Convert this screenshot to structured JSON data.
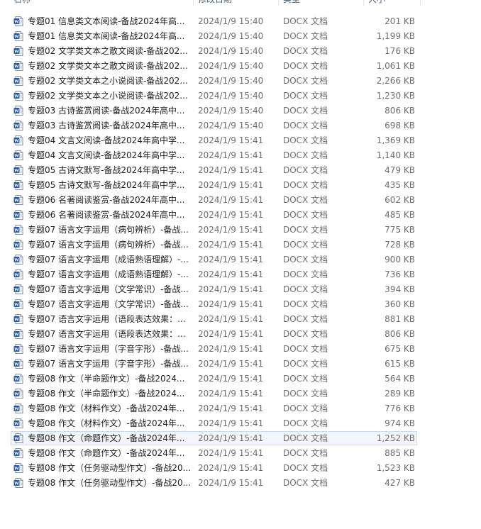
{
  "header": {
    "name": "名称",
    "date": "修改日期",
    "type": "类型",
    "size": "大小"
  },
  "icon": "word-document-icon",
  "accent_color": "#2b579a",
  "files": [
    {
      "name": "专题01 信息类文本阅读-备战2024年高...",
      "date": "2024/1/9 15:40",
      "type": "DOCX 文档",
      "size": "201 KB"
    },
    {
      "name": "专题01 信息类文本阅读-备战2024年高...",
      "date": "2024/1/9 15:40",
      "type": "DOCX 文档",
      "size": "1,199 KB"
    },
    {
      "name": "专题02 文学类文本之散文阅读-备战202...",
      "date": "2024/1/9 15:40",
      "type": "DOCX 文档",
      "size": "176 KB"
    },
    {
      "name": "专题02 文学类文本之散文阅读-备战202...",
      "date": "2024/1/9 15:40",
      "type": "DOCX 文档",
      "size": "1,061 KB"
    },
    {
      "name": "专题02 文学类文本之小说阅读-备战202...",
      "date": "2024/1/9 15:40",
      "type": "DOCX 文档",
      "size": "2,266 KB"
    },
    {
      "name": "专题02 文学类文本之小说阅读-备战202...",
      "date": "2024/1/9 15:40",
      "type": "DOCX 文档",
      "size": "1,230 KB"
    },
    {
      "name": "专题03 古诗鉴赏阅读-备战2024年高中...",
      "date": "2024/1/9 15:40",
      "type": "DOCX 文档",
      "size": "806 KB"
    },
    {
      "name": "专题03 古诗鉴赏阅读-备战2024年高中...",
      "date": "2024/1/9 15:40",
      "type": "DOCX 文档",
      "size": "698 KB"
    },
    {
      "name": "专题04 文言文阅读-备战2024年高中学...",
      "date": "2024/1/9 15:41",
      "type": "DOCX 文档",
      "size": "1,369 KB"
    },
    {
      "name": "专题04 文言文阅读-备战2024年高中学...",
      "date": "2024/1/9 15:41",
      "type": "DOCX 文档",
      "size": "1,140 KB"
    },
    {
      "name": "专题05 古诗文默写-备战2024年高中学...",
      "date": "2024/1/9 15:41",
      "type": "DOCX 文档",
      "size": "479 KB"
    },
    {
      "name": "专题05 古诗文默写-备战2024年高中学...",
      "date": "2024/1/9 15:41",
      "type": "DOCX 文档",
      "size": "435 KB"
    },
    {
      "name": "专题06 名著阅读鉴赏-备战2024年高中...",
      "date": "2024/1/9 15:41",
      "type": "DOCX 文档",
      "size": "602 KB"
    },
    {
      "name": "专题06 名著阅读鉴赏-备战2024年高中...",
      "date": "2024/1/9 15:41",
      "type": "DOCX 文档",
      "size": "485 KB"
    },
    {
      "name": "专题07 语言文字运用（病句辨析）-备战...",
      "date": "2024/1/9 15:41",
      "type": "DOCX 文档",
      "size": "775 KB"
    },
    {
      "name": "专题07 语言文字运用（病句辨析）-备战...",
      "date": "2024/1/9 15:41",
      "type": "DOCX 文档",
      "size": "728 KB"
    },
    {
      "name": "专题07 语言文字运用（成语熟语理解）-...",
      "date": "2024/1/9 15:41",
      "type": "DOCX 文档",
      "size": "900 KB"
    },
    {
      "name": "专题07 语言文字运用（成语熟语理解）-...",
      "date": "2024/1/9 15:41",
      "type": "DOCX 文档",
      "size": "736 KB"
    },
    {
      "name": "专题07 语言文字运用（文学常识）-备战...",
      "date": "2024/1/9 15:41",
      "type": "DOCX 文档",
      "size": "394 KB"
    },
    {
      "name": "专题07 语言文字运用（文学常识）-备战...",
      "date": "2024/1/9 15:41",
      "type": "DOCX 文档",
      "size": "360 KB"
    },
    {
      "name": "专题07 语言文字运用（语段表达效果：...",
      "date": "2024/1/9 15:41",
      "type": "DOCX 文档",
      "size": "881 KB"
    },
    {
      "name": "专题07 语言文字运用（语段表达效果：...",
      "date": "2024/1/9 15:41",
      "type": "DOCX 文档",
      "size": "806 KB"
    },
    {
      "name": "专题07 语言文字运用（字音字形）-备战...",
      "date": "2024/1/9 15:41",
      "type": "DOCX 文档",
      "size": "675 KB"
    },
    {
      "name": "专题07 语言文字运用（字音字形）-备战...",
      "date": "2024/1/9 15:41",
      "type": "DOCX 文档",
      "size": "615 KB"
    },
    {
      "name": "专题08 作文（半命题作文）-备战2024...",
      "date": "2024/1/9 15:41",
      "type": "DOCX 文档",
      "size": "564 KB"
    },
    {
      "name": "专题08 作文（半命题作文）-备战2024...",
      "date": "2024/1/9 15:41",
      "type": "DOCX 文档",
      "size": "289 KB"
    },
    {
      "name": "专题08 作文（材料作文）-备战2024年...",
      "date": "2024/1/9 15:41",
      "type": "DOCX 文档",
      "size": "776 KB"
    },
    {
      "name": "专题08 作文（材料作文）-备战2024年...",
      "date": "2024/1/9 15:41",
      "type": "DOCX 文档",
      "size": "974 KB"
    },
    {
      "name": "专题08 作文（命题作文）-备战2024年...",
      "date": "2024/1/9 15:41",
      "type": "DOCX 文档",
      "size": "1,252 KB",
      "selected": true
    },
    {
      "name": "专题08 作文（命题作文）-备战2024年...",
      "date": "2024/1/9 15:41",
      "type": "DOCX 文档",
      "size": "885 KB"
    },
    {
      "name": "专题08 作文（任务驱动型作文）-备战20...",
      "date": "2024/1/9 15:41",
      "type": "DOCX 文档",
      "size": "1,523 KB"
    },
    {
      "name": "专题08 作文（任务驱动型作文）-备战20...",
      "date": "2024/1/9 15:41",
      "type": "DOCX 文档",
      "size": "427 KB"
    }
  ]
}
